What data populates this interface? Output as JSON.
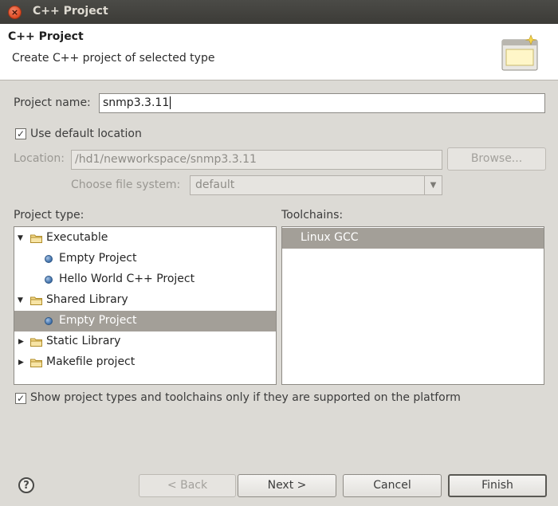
{
  "window": {
    "title": "C++ Project"
  },
  "header": {
    "title": "C++ Project",
    "description": "Create C++ project of selected type"
  },
  "form": {
    "project_name_label": "Project name:",
    "project_name_value": "snmp3.3.11",
    "use_default_location_label": "Use default location",
    "use_default_location_checked": true,
    "location_label": "Location:",
    "location_value": "/hd1/newworkspace/snmp3.3.11",
    "browse_label": "Browse...",
    "file_system_label": "Choose file system:",
    "file_system_value": "default"
  },
  "project_type": {
    "label": "Project type:",
    "items": [
      {
        "label": "Executable",
        "kind": "folder",
        "expanded": true
      },
      {
        "label": "Empty Project",
        "kind": "leaf"
      },
      {
        "label": "Hello World C++ Project",
        "kind": "leaf"
      },
      {
        "label": "Shared Library",
        "kind": "folder",
        "expanded": true
      },
      {
        "label": "Empty Project",
        "kind": "leaf",
        "selected": true
      },
      {
        "label": "Static Library",
        "kind": "folder",
        "expanded": false
      },
      {
        "label": "Makefile project",
        "kind": "folder",
        "expanded": false
      }
    ]
  },
  "toolchains": {
    "label": "Toolchains:",
    "items": [
      {
        "label": "Linux GCC",
        "selected": true
      }
    ]
  },
  "show_supported": {
    "label": "Show project types and toolchains only if they are supported on the platform",
    "checked": true
  },
  "buttons": {
    "back": "< Back",
    "next": "Next >",
    "cancel": "Cancel",
    "finish": "Finish"
  },
  "icons": {
    "close": "close-icon",
    "help": "help-icon",
    "header_image": "wizard-banner-icon",
    "folder": "folder-icon",
    "project_type": "project-type-icon"
  },
  "colors": {
    "titlebar": "#3c3b37",
    "close": "#de4a22",
    "selection": "#a39f98",
    "background": "#dcdad5"
  }
}
